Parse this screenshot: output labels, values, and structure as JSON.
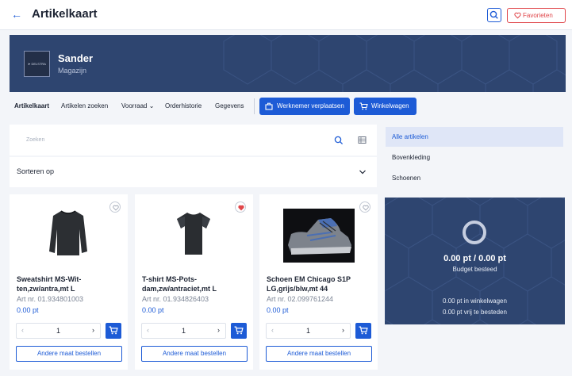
{
  "header": {
    "title": "Artikelkaart",
    "favorites_label": "Favorieten"
  },
  "banner": {
    "logo_text": "➤ DELSTRA",
    "user_name": "Sander",
    "user_role": "Magazijn"
  },
  "nav": {
    "items": [
      "Artikelkaart",
      "Artikelen zoeken",
      "Voorraad",
      "Orderhistorie",
      "Gegevens"
    ],
    "buttons": [
      "Werknemer verplaatsen",
      "Winkelwagen"
    ]
  },
  "search": {
    "placeholder": "Zoeken"
  },
  "sort": {
    "label": "Sorteren op"
  },
  "products": [
    {
      "name": "Sweatshirt MS-Wit-ten,zw/antra,mt L",
      "art": "Art nr. 01.934801003",
      "price": "0.00 pt",
      "qty": "1",
      "favorite": false,
      "order_label": "Andere maat bestellen"
    },
    {
      "name": "T-shirt MS-Pots-dam,zw/antraciet,mt L",
      "art": "Art nr. 01.934826403",
      "price": "0.00 pt",
      "qty": "1",
      "favorite": true,
      "order_label": "Andere maat bestellen"
    },
    {
      "name": "Schoen EM Chicago S1P LG,grijs/blw,mt 44",
      "art": "Art nr. 02.099761244",
      "price": "0.00 pt",
      "qty": "1",
      "favorite": false,
      "order_label": "Andere maat bestellen"
    }
  ],
  "categories": [
    "Alle artikelen",
    "Bovenkleding",
    "Schoenen"
  ],
  "budget": {
    "amount": "0.00 pt / 0.00 pt",
    "label": "Budget besteed",
    "in_cart": "0.00 pt in winkelwagen",
    "free": "0.00 pt vrij te besteden"
  },
  "colors": {
    "primary": "#1d5bd6",
    "navy": "#2e4570",
    "favorite": "#e0464a",
    "background": "#f3f5f9"
  }
}
